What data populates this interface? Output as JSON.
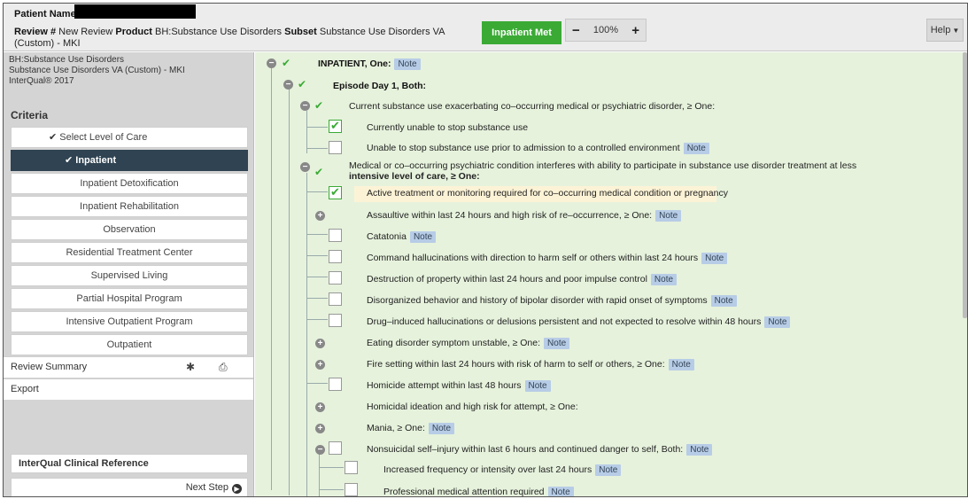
{
  "header": {
    "patient_label": "Patient Name/ID",
    "review_label": "Review #",
    "review_value": "New Review",
    "product_label": "Product",
    "product_value": "BH:Substance Use Disorders",
    "subset_label": "Subset",
    "subset_value": "Substance Use Disorders VA (Custom) - MKI",
    "inpatient_met_label": "Inpatient Met",
    "zoom_minus": "−",
    "zoom_value": "100%",
    "zoom_plus": "+",
    "help_label": "Help"
  },
  "sidebar": {
    "product_line1": "BH:Substance Use Disorders",
    "product_line2": "Substance Use Disorders VA (Custom) - MKI",
    "product_line3": "InterQual® 2017",
    "criteria_label": "Criteria",
    "levels": [
      {
        "label": "Select Level of Care"
      },
      {
        "label": "Inpatient"
      },
      {
        "label": "Inpatient Detoxification"
      },
      {
        "label": "Inpatient Rehabilitation"
      },
      {
        "label": "Observation"
      },
      {
        "label": "Residential Treatment Center"
      },
      {
        "label": "Supervised Living"
      },
      {
        "label": "Partial Hospital Program"
      },
      {
        "label": "Intensive Outpatient Program"
      },
      {
        "label": "Outpatient"
      }
    ],
    "review_summary_label": "Review Summary",
    "export_label": "Export",
    "clinical_reference_label": "InterQual Clinical Reference",
    "next_step_label": "Next Step"
  },
  "tree": {
    "note_label": "Note",
    "root": "INPATIENT, One:",
    "episode": "Episode Day 1, Both:",
    "group1": "Current substance use exacerbating co–occurring medical or psychiatric disorder, ≥ One:",
    "g1_items": [
      "Currently unable to stop substance use",
      "Unable to stop substance use prior to admission to a controlled environment"
    ],
    "group2_line1": "Medical or co–occurring psychiatric condition interferes with ability to participate in substance use disorder treatment at less",
    "group2_line2": "intensive level of care, ≥ One:",
    "g2_items": [
      "Active treatment or monitoring required for co–occurring medical condition or pregnancy",
      "Assaultive within last 24 hours and high risk of re–occurrence, ≥ One:",
      "Catatonia",
      "Command hallucinations with direction to harm self or others within last 24 hours",
      "Destruction of property within last 24 hours and poor impulse control",
      "Disorganized behavior and history of bipolar disorder with rapid onset of symptoms",
      "Drug–induced hallucinations or delusions persistent and not expected to resolve within 48 hours",
      "Eating disorder symptom unstable, ≥ One:",
      "Fire setting within last 24 hours with risk of harm to self or others, ≥ One:",
      "Homicide attempt within last 48 hours",
      "Homicidal ideation and high risk for attempt, ≥ One:",
      "Mania, ≥ One:",
      "Nonsuicidal self–injury within last 6 hours and continued danger to self, Both:"
    ],
    "sub_items": [
      "Increased frequency or intensity over last 24 hours",
      "Professional medical attention required"
    ]
  },
  "colors": {
    "met_green": "#3aaa35",
    "selected_nav": "#2f4352",
    "tree_bg": "#e6f2dc",
    "note_bg": "#b7cce6",
    "highlight": "#fcf3d6"
  }
}
